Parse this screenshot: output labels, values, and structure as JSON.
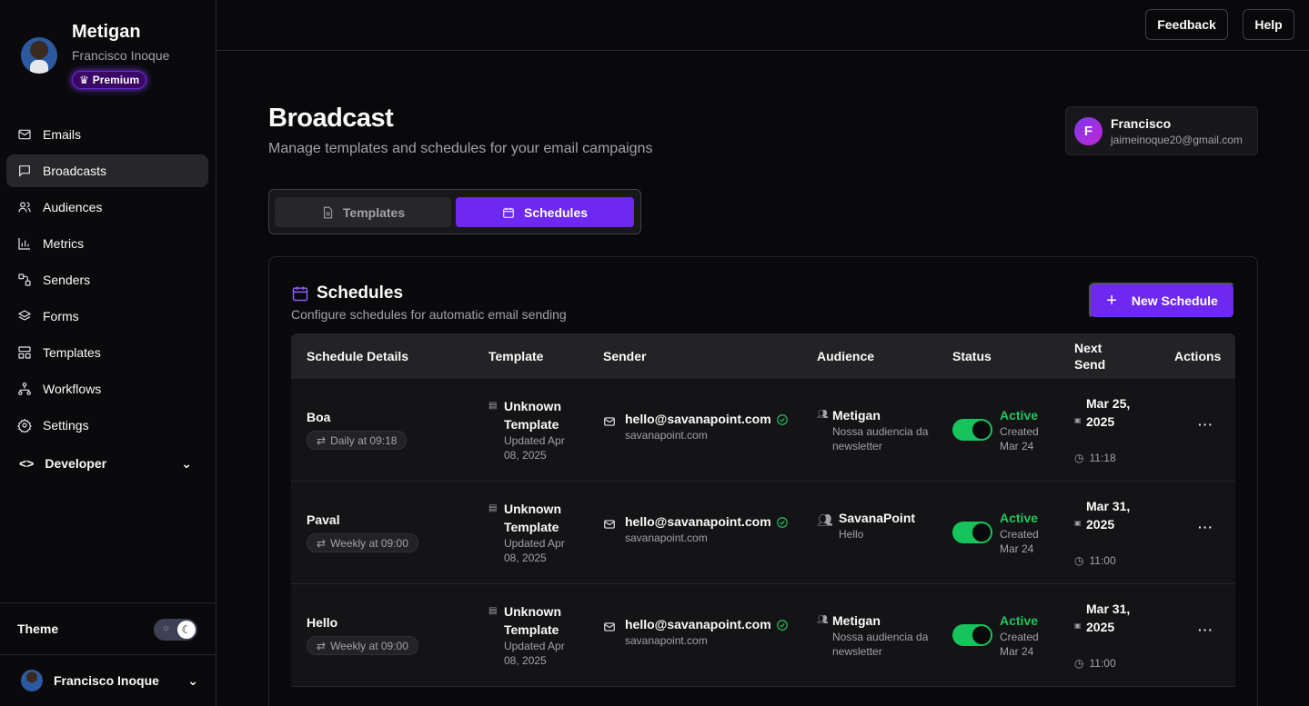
{
  "brand": {
    "name": "Metigan",
    "user": "Francisco Inoque",
    "badge": "Premium"
  },
  "sidebar": {
    "items": [
      {
        "label": "Emails",
        "icon": "mail-icon"
      },
      {
        "label": "Broadcasts",
        "icon": "message-square-icon",
        "active": true
      },
      {
        "label": "Audiences",
        "icon": "users-icon"
      },
      {
        "label": "Metrics",
        "icon": "bar-chart-icon"
      },
      {
        "label": "Senders",
        "icon": "route-icon"
      },
      {
        "label": "Forms",
        "icon": "layers-icon"
      },
      {
        "label": "Templates",
        "icon": "layout-icon"
      },
      {
        "label": "Workflows",
        "icon": "workflow-icon"
      },
      {
        "label": "Settings",
        "icon": "gear-icon"
      }
    ],
    "developer": "Developer",
    "theme_label": "Theme",
    "footer_user": "Francisco Inoque"
  },
  "topbar": {
    "feedback": "Feedback",
    "help": "Help"
  },
  "page": {
    "title": "Broadcast",
    "subtitle": "Manage templates and schedules for your email campaigns"
  },
  "account": {
    "initial": "F",
    "name": "Francisco",
    "email": "jaimeinoque20@gmail.com"
  },
  "tabs": {
    "templates": "Templates",
    "schedules": "Schedules"
  },
  "card": {
    "title": "Schedules",
    "subtitle": "Configure schedules for automatic email sending",
    "new_button": "New Schedule"
  },
  "table": {
    "headers": [
      "Schedule Details",
      "Template",
      "Sender",
      "Audience",
      "Status",
      "Next Send",
      "Actions"
    ],
    "rows": [
      {
        "name": "Boa",
        "frequency": "Daily at 09:18",
        "template": "Unknown Template",
        "template_updated": "Updated Apr 08, 2025",
        "sender": "hello@savanapoint.com",
        "sender_domain": "savanapoint.com",
        "audience": "Metigan",
        "audience_desc": "Nossa audiencia da newsletter",
        "status": "Active",
        "created": "Created Mar 24",
        "next_date": "Mar 25, 2025",
        "next_time": "11:18",
        "actions": "···"
      },
      {
        "name": "Paval",
        "frequency": "Weekly at 09:00",
        "template": "Unknown Template",
        "template_updated": "Updated Apr 08, 2025",
        "sender": "hello@savanapoint.com",
        "sender_domain": "savanapoint.com",
        "audience": "SavanaPoint",
        "audience_desc": "Hello",
        "status": "Active",
        "created": "Created Mar 24",
        "next_date": "Mar 31, 2025",
        "next_time": "11:00",
        "actions": "···"
      },
      {
        "name": "Hello",
        "frequency": "Weekly at 09:00",
        "template": "Unknown Template",
        "template_updated": "Updated Apr 08, 2025",
        "sender": "hello@savanapoint.com",
        "sender_domain": "savanapoint.com",
        "audience": "Metigan",
        "audience_desc": "Nossa audiencia da newsletter",
        "status": "Active",
        "created": "Created Mar 24",
        "next_date": "Mar 31, 2025",
        "next_time": "11:00",
        "actions": "···"
      }
    ]
  },
  "colors": {
    "accent": "#6d28f2",
    "active_green": "#22c55e",
    "background": "#09090b"
  }
}
